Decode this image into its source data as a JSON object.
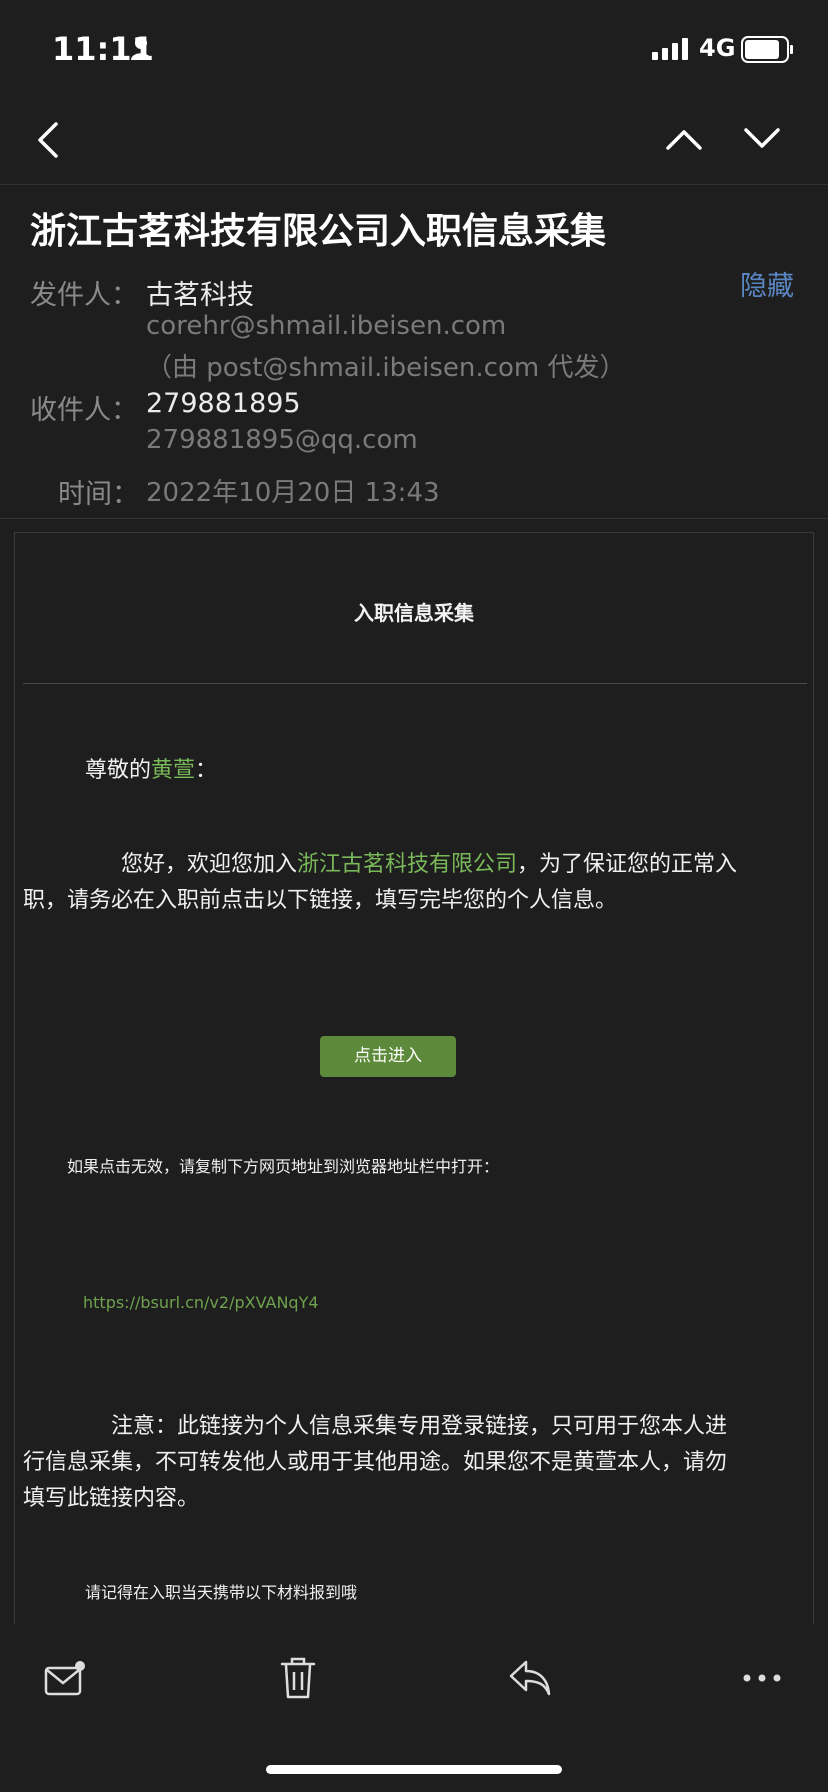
{
  "status_bar": {
    "time": "11:11",
    "network": "4G"
  },
  "header": {
    "subject": "浙江古茗科技有限公司入职信息采集",
    "hide_label": "隐藏",
    "sender_label": "发件人：",
    "sender_name": "古茗科技",
    "sender_email": "corehr@shmail.ibeisen.com",
    "sender_via": "（由 post@shmail.ibeisen.com 代发）",
    "recipient_label": "收件人：",
    "recipient_name": "279881895",
    "recipient_email": "279881895@qq.com",
    "time_label": "时间：",
    "time_value": "2022年10月20日 13:43"
  },
  "email_body": {
    "title": "入职信息采集",
    "greeting_prefix": "尊敬的",
    "greeting_name": "黄萱",
    "greeting_suffix": "：",
    "intro_prefix": "您好，欢迎您加入",
    "intro_company": "浙江古茗科技有限公司",
    "intro_line1_suffix": "，为了保证您的正常入",
    "intro_line2": "职，请务必在入职前点击以下链接，填写完毕您的个人信息。",
    "enter_button": "点击进入",
    "fallback_text": "如果点击无效，请复制下方网页地址到浏览器地址栏中打开：",
    "link_url": "https://bsurl.cn/v2/pXVANqY4",
    "notice_line1": "注意：此链接为个人信息采集专用登录链接，只可用于您本人进",
    "notice_line2": "行信息采集，不可转发他人或用于其他用途。如果您不是黄萱本人，请勿",
    "notice_line3": "填写此链接内容。",
    "reminder": "请记得在入职当天携带以下材料报到哦"
  },
  "toolbar": {
    "icons": [
      "mail-unread-icon",
      "trash-icon",
      "reply-icon",
      "more-icon"
    ]
  },
  "colors": {
    "background": "#1e1e1e",
    "accent_blue": "#5a86c4",
    "accent_green": "#7ab95a",
    "button_green": "#5d8a3a"
  }
}
